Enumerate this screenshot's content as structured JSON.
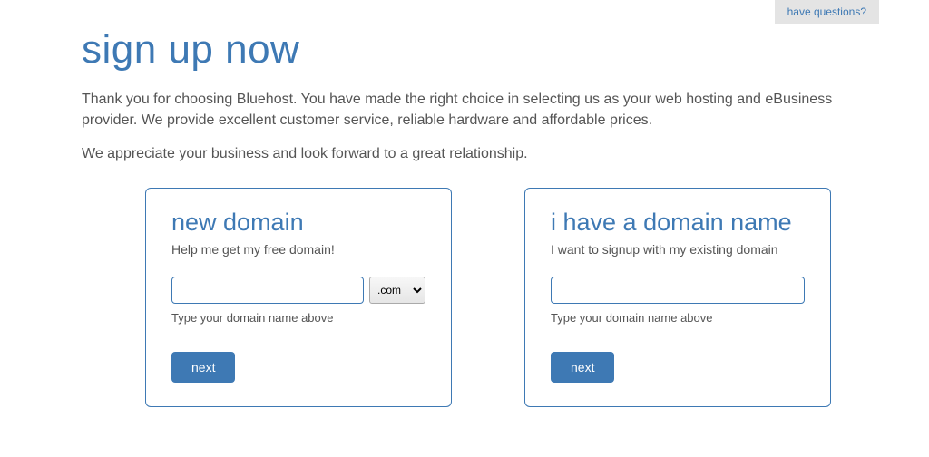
{
  "header": {
    "questions_label": "have questions?"
  },
  "page": {
    "title": "sign up now",
    "intro1": "Thank you for choosing Bluehost. You have made the right choice in selecting us as your web hosting and eBusiness provider. We provide excellent customer service, reliable hardware and affordable prices.",
    "intro2": "We appreciate your business and look forward to a great relationship."
  },
  "new_domain": {
    "title": "new domain",
    "sub": "Help me get my free domain!",
    "input_value": "",
    "tld_selected": ".com",
    "hint": "Type your domain name above",
    "next_label": "next"
  },
  "have_domain": {
    "title": "i have a domain name",
    "sub": "I want to signup with my existing domain",
    "input_value": "",
    "hint": "Type your domain name above",
    "next_label": "next"
  }
}
